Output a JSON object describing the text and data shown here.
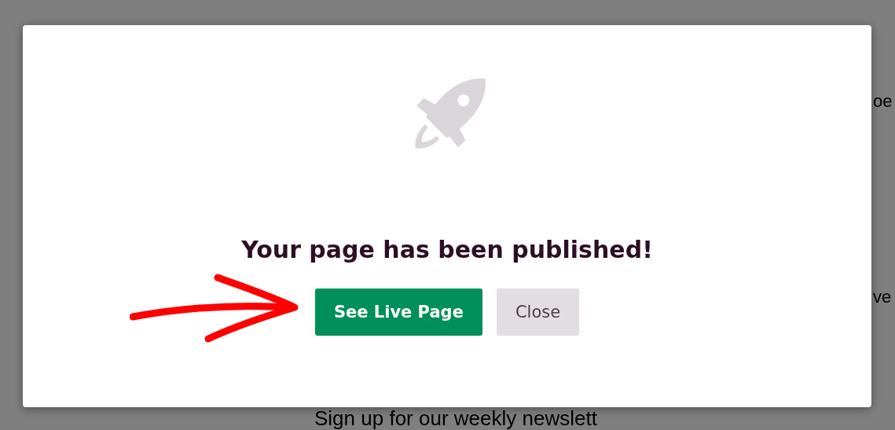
{
  "background_page": {
    "text_fragments": [
      "oe",
      "ve"
    ],
    "heading": "Sign up for our weekly newslett"
  },
  "modal": {
    "title": "Your page has been published!",
    "buttons": [
      {
        "label": "See Live Page",
        "kind": "primary"
      },
      {
        "label": "Close",
        "kind": "secondary"
      }
    ]
  }
}
